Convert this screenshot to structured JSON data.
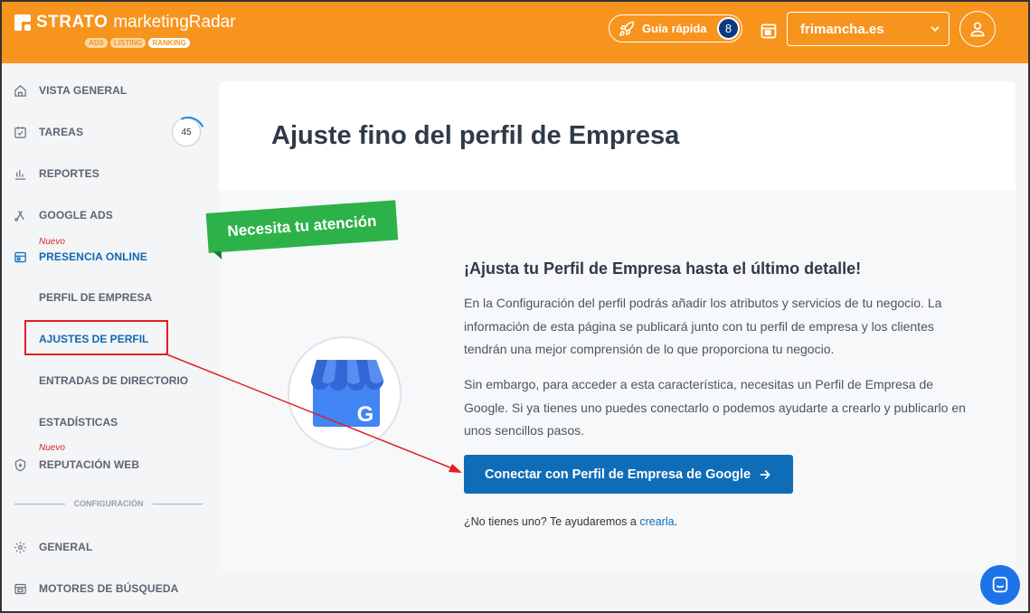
{
  "app": {
    "brand": "STRATO",
    "product": "marketingRadar",
    "tags": [
      "ADS",
      "LISTING",
      "RANKING"
    ]
  },
  "header": {
    "guide_label": "Guía rápida",
    "guide_count": "8",
    "domain": "frimancha.es"
  },
  "sidebar": {
    "items": [
      {
        "label": "VISTA GENERAL",
        "icon": "home-icon"
      },
      {
        "label": "TAREAS",
        "icon": "checklist-icon",
        "count": "45"
      },
      {
        "label": "REPORTES",
        "icon": "bar-chart-icon"
      },
      {
        "label": "GOOGLE ADS",
        "icon": "google-ads-icon"
      },
      {
        "label": "PRESENCIA ONLINE",
        "icon": "storefront-icon",
        "badge": "Nuevo"
      },
      {
        "label": "REPUTACIÓN WEB",
        "icon": "shield-star-icon",
        "badge": "Nuevo"
      }
    ],
    "sub_items": [
      "PERFIL DE EMPRESA",
      "AJUSTES DE PERFIL",
      "ENTRADAS DE DIRECTORIO",
      "ESTADÍSTICAS"
    ],
    "config_label": "CONFIGURACIÓN",
    "config_items": [
      {
        "label": "GENERAL",
        "icon": "gear-icon"
      },
      {
        "label": "MOTORES DE BÚSQUEDA",
        "icon": "browser-icon"
      }
    ]
  },
  "main": {
    "title": "Ajuste fino del perfil de Empresa",
    "attention_label": "Necesita tu atención",
    "section_title": "¡Ajusta tu Perfil de Empresa hasta el último detalle!",
    "paragraph1": "En la Configuración del perfil podrás añadir los atributos y servicios de tu negocio. La información de esta página se publicará junto con tu perfil de empresa y los clientes tendrán una mejor comprensión de lo que proporciona tu negocio.",
    "paragraph2": "Sin embargo, para acceder a esta característica, necesitas un Perfil de Empresa de Google. Si ya tienes uno puedes conectarlo o podemos ayudarte a crearlo y publicarlo en unos sencillos pasos.",
    "cta_label": "Conectar con Perfil de Empresa de Google",
    "no_account_text": "¿No tienes uno? Te ayudaremos a",
    "no_account_link": "crearla",
    "no_account_suffix": "."
  },
  "colors": {
    "header": "#f7941d",
    "primary": "#0f6db8",
    "attention": "#2db24a",
    "annotation": "#e31e24"
  }
}
